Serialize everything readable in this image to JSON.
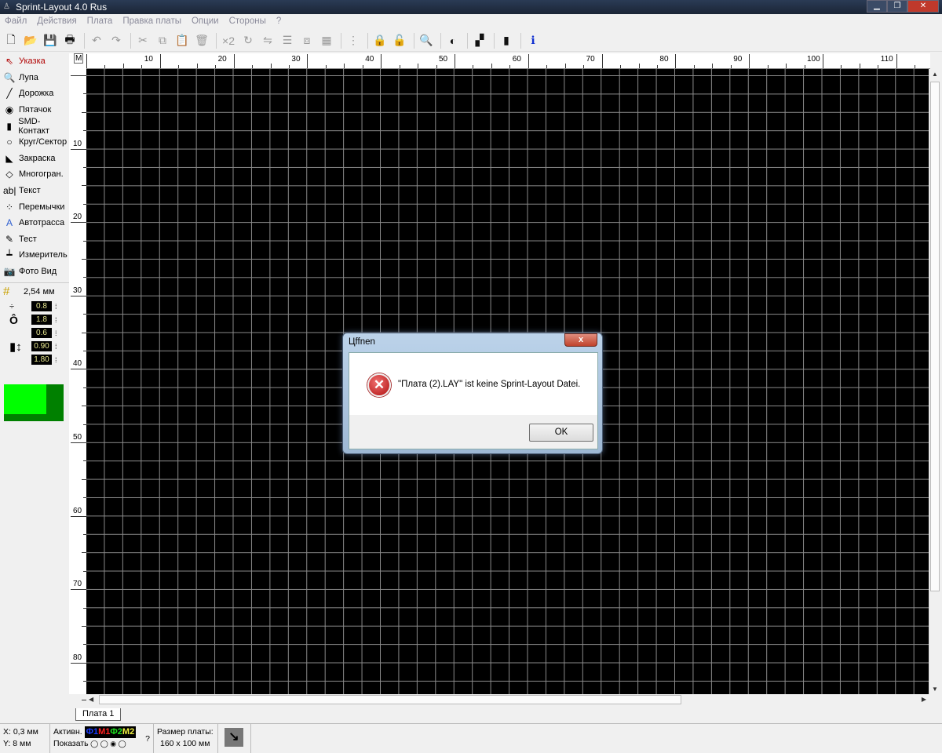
{
  "window": {
    "title": "Sprint-Layout 4.0 Rus"
  },
  "menu": [
    "Файл",
    "Действия",
    "Плата",
    "Правка платы",
    "Опции",
    "Стороны",
    "?"
  ],
  "toolbar": [
    {
      "icon": "new-file-icon",
      "g": "🗋",
      "on": true
    },
    {
      "icon": "open-folder-icon",
      "g": "📂",
      "on": true
    },
    {
      "icon": "save-icon",
      "g": "💾",
      "on": true
    },
    {
      "icon": "print-icon",
      "g": "🖶",
      "on": true
    },
    {
      "sep": true
    },
    {
      "icon": "undo-icon",
      "g": "↶"
    },
    {
      "icon": "redo-icon",
      "g": "↷"
    },
    {
      "sep": true
    },
    {
      "icon": "cut-icon",
      "g": "✂"
    },
    {
      "icon": "copy-icon",
      "g": "⧉"
    },
    {
      "icon": "paste-icon",
      "g": "📋"
    },
    {
      "icon": "delete-icon",
      "g": "🗑"
    },
    {
      "sep": true
    },
    {
      "icon": "duplicate-icon",
      "g": "×2"
    },
    {
      "icon": "rotate-icon",
      "g": "↻"
    },
    {
      "icon": "mirror-icon",
      "g": "⇋"
    },
    {
      "icon": "align-icon",
      "g": "☰"
    },
    {
      "icon": "group-icon",
      "g": "⧈"
    },
    {
      "icon": "pattern-icon",
      "g": "▦"
    },
    {
      "sep": true
    },
    {
      "icon": "connections-icon",
      "g": "⋮"
    },
    {
      "sep": true
    },
    {
      "icon": "lock-icon",
      "g": "🔒"
    },
    {
      "icon": "unlock-icon",
      "g": "🔓"
    },
    {
      "sep": true
    },
    {
      "icon": "zoom-icon",
      "g": "🔍",
      "on": true
    },
    {
      "sep": true
    },
    {
      "icon": "contrast-icon",
      "g": "◐",
      "on": true
    },
    {
      "sep": true
    },
    {
      "icon": "drc-icon",
      "g": "▞",
      "on": true
    },
    {
      "sep": true
    },
    {
      "icon": "macro-icon",
      "g": "▮",
      "on": true
    },
    {
      "sep": true
    },
    {
      "icon": "info-icon",
      "g": "ℹ",
      "on": true
    }
  ],
  "tools": [
    {
      "label": "Указка",
      "icon": "pointer-icon",
      "g": "⇖",
      "active": true
    },
    {
      "label": "Лупа",
      "icon": "magnifier-icon",
      "g": "🔍"
    },
    {
      "label": "Дорожка",
      "icon": "track-icon",
      "g": "╱"
    },
    {
      "label": "Пятачок",
      "icon": "pad-icon",
      "g": "◉"
    },
    {
      "label": "SMD-Контакт",
      "icon": "smd-pad-icon",
      "g": "▮"
    },
    {
      "label": "Круг/Сектор",
      "icon": "circle-icon",
      "g": "○"
    },
    {
      "label": "Закраска",
      "icon": "fill-icon",
      "g": "◣"
    },
    {
      "label": "Многогран.",
      "icon": "polygon-icon",
      "g": "◇"
    },
    {
      "label": "Текст",
      "icon": "text-icon",
      "g": "ab|"
    },
    {
      "label": "Перемычки",
      "icon": "jumper-icon",
      "g": "⁘"
    },
    {
      "label": "Автотрасса",
      "icon": "autoroute-icon",
      "g": "A"
    },
    {
      "label": "Тест",
      "icon": "test-icon",
      "g": "✎"
    },
    {
      "label": "Измеритель",
      "icon": "ruler-icon",
      "g": "┷"
    },
    {
      "label": "Фото Вид",
      "icon": "camera-icon",
      "g": "📷"
    }
  ],
  "grid": "2,54 мм",
  "track_width": "0.8",
  "pad_outer": "1.8",
  "pad_inner": "0.6",
  "smd_width": "0.90",
  "smd_height": "1.80",
  "ruler": {
    "corner": "M",
    "top": [
      "10",
      "20",
      "30",
      "40",
      "50",
      "60",
      "70",
      "80",
      "90",
      "100",
      "110"
    ],
    "left": [
      "10",
      "20",
      "30",
      "40",
      "50",
      "60",
      "70",
      "80"
    ]
  },
  "tab": "Плата 1",
  "status": {
    "x": "X: 0,3 мм",
    "y": "Y: 8 мм",
    "active_label": "Активн.",
    "show_label": "Показать",
    "layers": [
      {
        "t": "Ф1",
        "c": "#1a3cff"
      },
      {
        "t": "М1",
        "c": "#ff2020"
      },
      {
        "t": "Ф2",
        "c": "#20e020"
      },
      {
        "t": "М2",
        "c": "#f0f040"
      }
    ],
    "help": "?",
    "size_label": "Размер платы:",
    "size": "160 x 100 мм"
  },
  "dialog": {
    "title": "Цffnen",
    "message": "\"Плата (2).LAY\" ist keine Sprint-Layout Datei.",
    "ok": "OK"
  }
}
